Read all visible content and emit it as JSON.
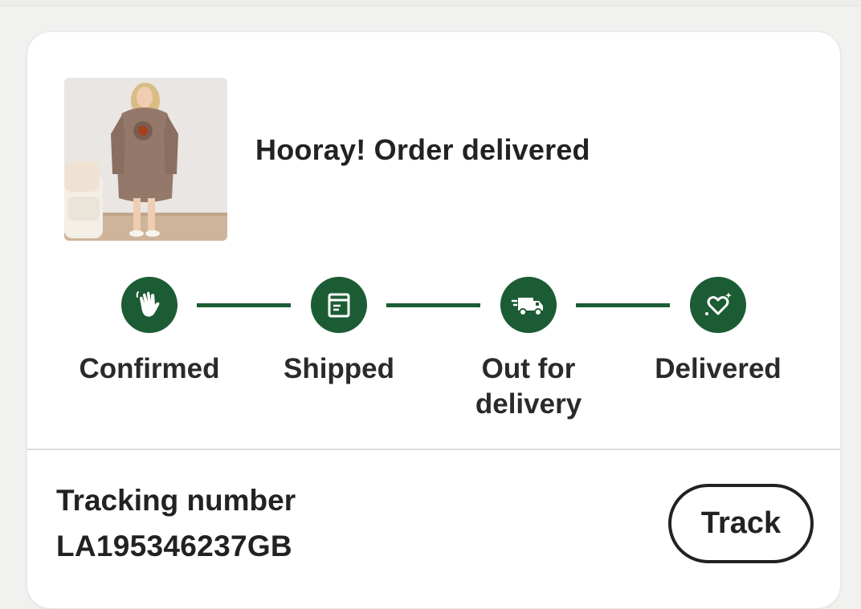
{
  "order": {
    "title": "Hooray! Order delivered",
    "product_image": "hoodie-blanket-product-photo"
  },
  "progress": {
    "steps": [
      {
        "label": "Confirmed",
        "icon": "waving-hand-icon",
        "complete": true
      },
      {
        "label": "Shipped",
        "icon": "package-box-icon",
        "complete": true
      },
      {
        "label": "Out for delivery",
        "icon": "delivery-truck-icon",
        "complete": true
      },
      {
        "label": "Delivered",
        "icon": "sparkle-heart-icon",
        "complete": true
      }
    ]
  },
  "tracking": {
    "label": "Tracking number",
    "number": "LA195346237GB",
    "button_label": "Track"
  },
  "colors": {
    "accent": "#1c5c34",
    "text": "#222222",
    "card": "#ffffff",
    "background": "#f1f1f0"
  }
}
